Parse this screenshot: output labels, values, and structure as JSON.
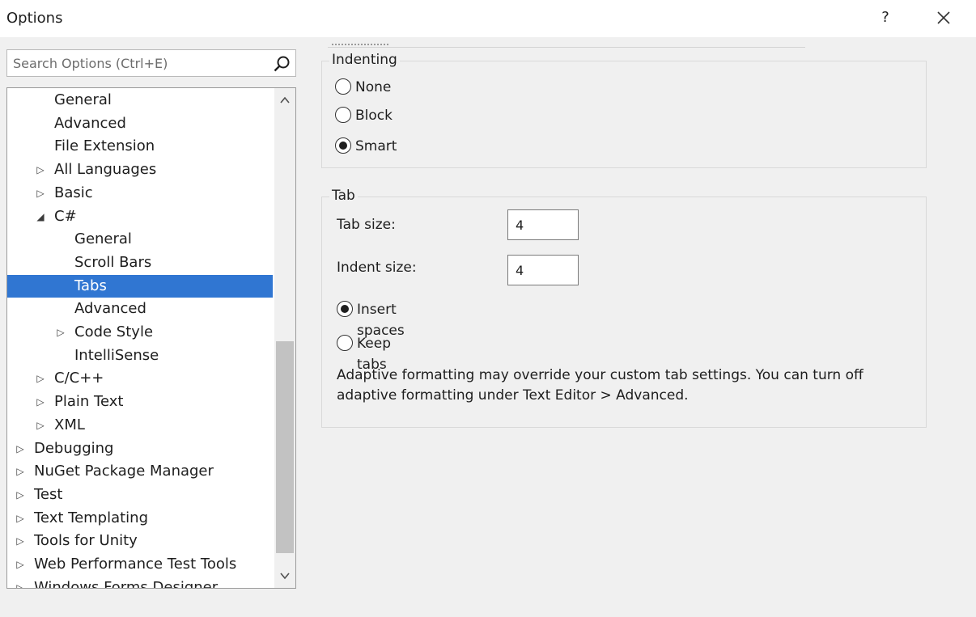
{
  "window": {
    "title": "Options",
    "help_label": "?"
  },
  "search": {
    "placeholder": "Search Options (Ctrl+E)"
  },
  "tree": {
    "items": [
      {
        "label": "General",
        "arrow": ""
      },
      {
        "label": "Advanced",
        "arrow": ""
      },
      {
        "label": "File Extension",
        "arrow": ""
      },
      {
        "label": "All Languages",
        "arrow": "▷"
      },
      {
        "label": "Basic",
        "arrow": "▷"
      },
      {
        "label": "C#",
        "arrow": "◢"
      },
      {
        "label": "General",
        "arrow": ""
      },
      {
        "label": "Scroll Bars",
        "arrow": ""
      },
      {
        "label": "Tabs",
        "arrow": "",
        "selected": true
      },
      {
        "label": "Advanced",
        "arrow": ""
      },
      {
        "label": "Code Style",
        "arrow": "▷"
      },
      {
        "label": "IntelliSense",
        "arrow": ""
      },
      {
        "label": "C/C++",
        "arrow": "▷"
      },
      {
        "label": "Plain Text",
        "arrow": "▷"
      },
      {
        "label": "XML",
        "arrow": "▷"
      },
      {
        "label": "Debugging",
        "arrow": "▷"
      },
      {
        "label": "NuGet Package Manager",
        "arrow": "▷"
      },
      {
        "label": "Test",
        "arrow": "▷"
      },
      {
        "label": "Text Templating",
        "arrow": "▷"
      },
      {
        "label": "Tools for Unity",
        "arrow": "▷"
      },
      {
        "label": "Web Performance Test Tools",
        "arrow": "▷"
      },
      {
        "label": "Windows Forms Designer",
        "arrow": "▷"
      }
    ],
    "scroll_up": "^",
    "scroll_down": "v"
  },
  "indenting": {
    "legend": "Indenting",
    "options": [
      {
        "label": "None",
        "checked": false
      },
      {
        "label": "Block",
        "checked": false
      },
      {
        "label": "Smart",
        "checked": true
      }
    ]
  },
  "tab": {
    "legend": "Tab",
    "tab_size_label": "Tab size:",
    "tab_size_value": "4",
    "indent_size_label": "Indent size:",
    "indent_size_value": "4",
    "insert_spaces_label": "Insert spaces",
    "insert_spaces_checked": true,
    "keep_tabs_label": "Keep tabs",
    "keep_tabs_checked": false,
    "note": "Adaptive formatting may override your custom tab settings. You can turn off adaptive formatting under Text Editor > Advanced."
  },
  "colors": {
    "selection": "#3076d2",
    "background": "#f0f0f0"
  }
}
